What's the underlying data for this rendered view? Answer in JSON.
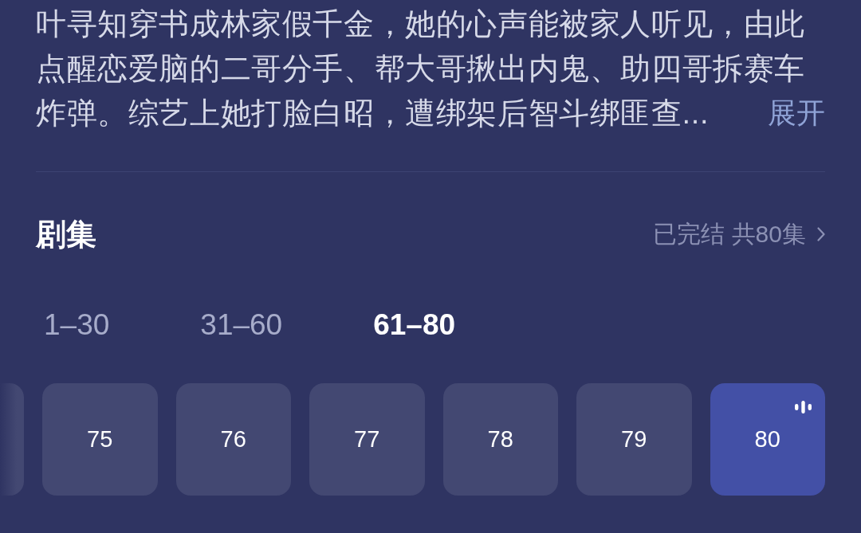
{
  "synopsis": {
    "text": "叶寻知穿书成林家假千金，她的心声能被家人听见，由此点醒恋爱脑的二哥分手、帮大哥揪出内鬼、助四哥拆赛车炸弹。综艺上她打脸白昭，遭绑架后智斗绑匪查...",
    "expand_label": "展开"
  },
  "episodes_header": {
    "title": "剧集",
    "status": "已完结 共80集"
  },
  "range_tabs": [
    {
      "label": "1–30",
      "selected": false
    },
    {
      "label": "31–60",
      "selected": false
    },
    {
      "label": "61–80",
      "selected": true
    }
  ],
  "episodes": {
    "clipped_before": true,
    "items": [
      {
        "label": "75",
        "selected": false,
        "playing": false
      },
      {
        "label": "76",
        "selected": false,
        "playing": false
      },
      {
        "label": "77",
        "selected": false,
        "playing": false
      },
      {
        "label": "78",
        "selected": false,
        "playing": false
      },
      {
        "label": "79",
        "selected": false,
        "playing": false
      },
      {
        "label": "80",
        "selected": true,
        "playing": true
      }
    ]
  }
}
